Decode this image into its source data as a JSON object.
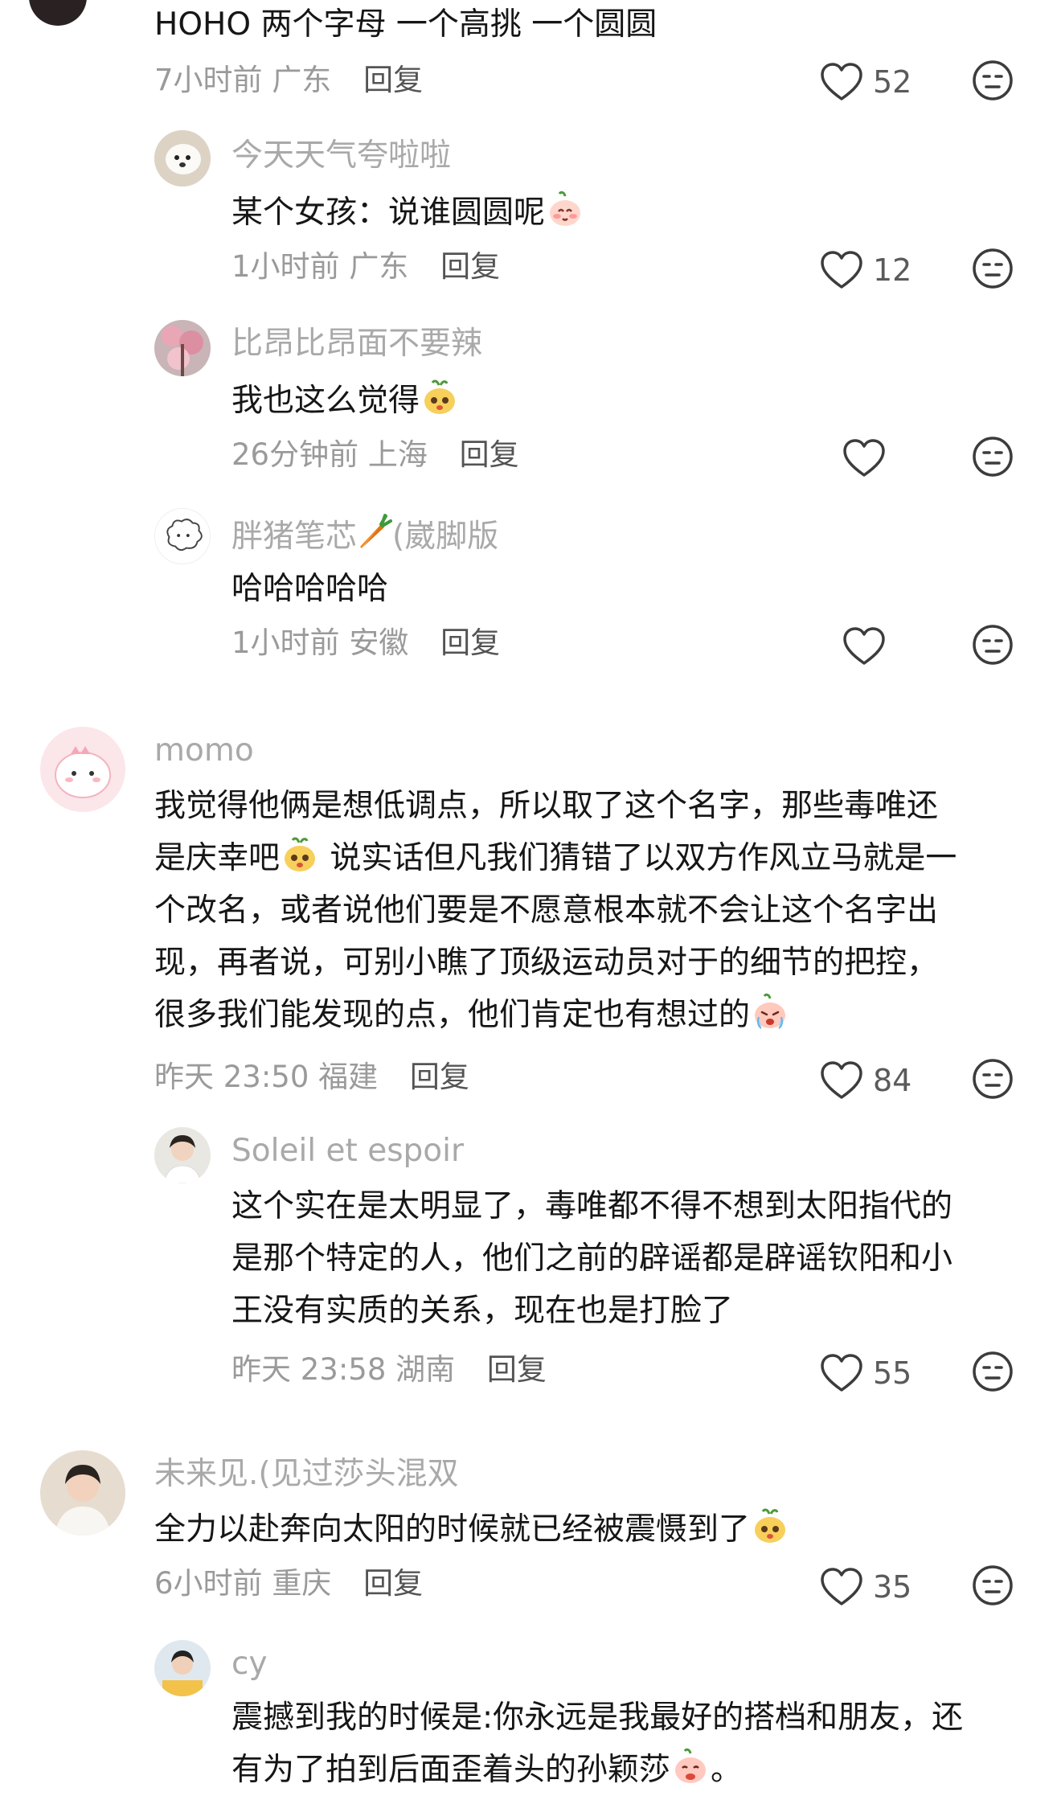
{
  "comments": [
    {
      "text": "HOHO 两个字母 一个高挑 一个圆圆",
      "time": "7小时前",
      "loc": "广东",
      "reply": "回复",
      "likes": "52"
    },
    {
      "name": "今天天气夸啦啦",
      "text": "某个女孩：说谁圆圆呢",
      "time": "1小时前",
      "loc": "广东",
      "reply": "回复",
      "likes": "12"
    },
    {
      "name": "比昂比昂面不要辣",
      "text": "我也这么觉得",
      "time": "26分钟前",
      "loc": "上海",
      "reply": "回复"
    },
    {
      "name": "胖猪笔芯",
      "name_suffix": "(崴脚版",
      "text": "哈哈哈哈哈",
      "time": "1小时前",
      "loc": "安徽",
      "reply": "回复"
    },
    {
      "name": "momo",
      "text_lines": [
        "我觉得他俩是想低调点，所以取了这个名字，那些毒唯还",
        "是庆幸吧",
        " 说实话但凡我们猜错了以双方作风立马就是一",
        "个改名，或者说他们要是不愿意根本就不会让这个名字出",
        "现，再者说，可别小瞧了顶级运动员对于的细节的把控，",
        "很多我们能发现的点，他们肯定也有想过的"
      ],
      "time": "昨天 23:50",
      "loc": "福建",
      "reply": "回复",
      "likes": "84"
    },
    {
      "name": "Soleil et espoir",
      "text_lines": [
        "这个实在是太明显了，毒唯都不得不想到太阳指代的",
        "是那个特定的人，他们之前的辟谣都是辟谣钦阳和小",
        "王没有实质的关系，现在也是打脸了"
      ],
      "time": "昨天 23:58",
      "loc": "湖南",
      "reply": "回复",
      "likes": "55"
    },
    {
      "name": "未来见.(见过莎头混双",
      "text": "全力以赴奔向太阳的时候就已经被震慑到了",
      "time": "6小时前",
      "loc": "重庆",
      "reply": "回复",
      "likes": "35"
    },
    {
      "name": "cy",
      "text_lines": [
        "震撼到我的时候是:你永远是我最好的搭档和朋友，还",
        "有为了拍到后面歪着头的孙颖莎",
        "。"
      ]
    }
  ],
  "icons": {
    "like": "heart-outline-icon",
    "dislike": "unamused-face-icon"
  },
  "colors": {
    "name": "#a9a9a9",
    "meta": "#9a9a9a",
    "text": "#161616",
    "reply": "#545454"
  }
}
